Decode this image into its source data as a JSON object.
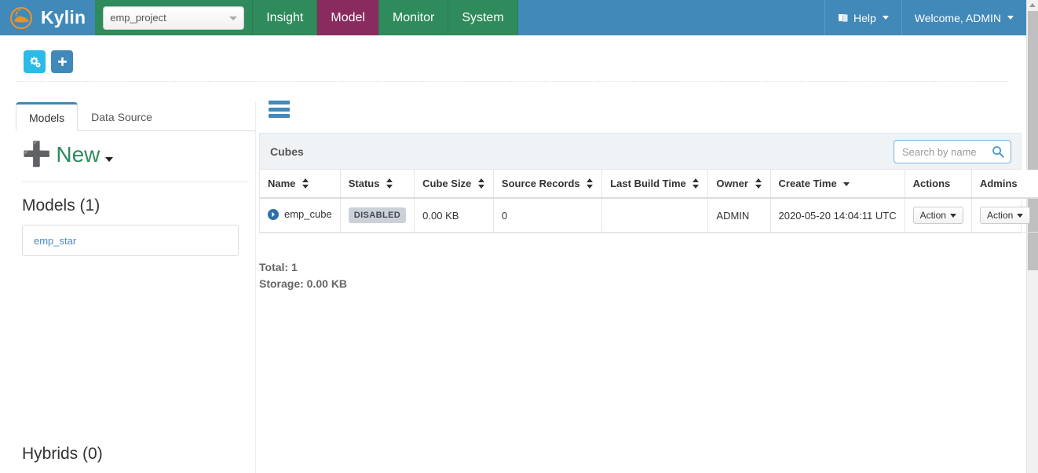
{
  "navbar": {
    "brand": "Kylin",
    "brand_logo_icon": "kylin-logo-icon",
    "project_selector": {
      "value": "emp_project",
      "icon": "chevron-down-icon"
    },
    "items": [
      {
        "label": "Insight",
        "active": false
      },
      {
        "label": "Model",
        "active": true
      },
      {
        "label": "Monitor",
        "active": false
      },
      {
        "label": "System",
        "active": false
      }
    ],
    "help": {
      "label": "Help",
      "icon": "book-icon",
      "caret": "caret-down-icon"
    },
    "user": {
      "label": "Welcome, ADMIN",
      "caret": "caret-down-icon"
    },
    "colors": {
      "bar_background": "#4189b8",
      "nav_green": "#2f8a5c",
      "nav_active": "#8a2b60"
    }
  },
  "toolbar": {
    "buttons": [
      {
        "name": "manage-project-button",
        "icon": "gears-icon",
        "color": "#2bbbe6"
      },
      {
        "name": "add-project-button",
        "icon": "plus-icon",
        "color": "#4189b8"
      }
    ]
  },
  "left_panel": {
    "tabs": [
      {
        "label": "Models",
        "active": true
      },
      {
        "label": "Data Source",
        "active": false
      }
    ],
    "new_button": {
      "label": "New",
      "plus_icon": "plus-icon",
      "caret": "caret-down-icon"
    },
    "models_section": {
      "title": "Models (1)",
      "items": [
        {
          "label": "emp_star"
        }
      ]
    },
    "hybrids_section": {
      "title": "Hybrids (0)"
    }
  },
  "content": {
    "list_toggle_icon": "hamburger-icon",
    "panel": {
      "title": "Cubes",
      "search": {
        "placeholder": "Search by name",
        "value": "",
        "icon": "search-icon"
      }
    },
    "table": {
      "columns": [
        {
          "label": "Name",
          "sort": "both"
        },
        {
          "label": "Status",
          "sort": "both"
        },
        {
          "label": "Cube Size",
          "sort": "both"
        },
        {
          "label": "Source Records",
          "sort": "both"
        },
        {
          "label": "Last Build Time",
          "sort": "both"
        },
        {
          "label": "Owner",
          "sort": "both"
        },
        {
          "label": "Create Time",
          "sort": "desc"
        },
        {
          "label": "Actions",
          "sort": "none"
        },
        {
          "label": "Admins",
          "sort": "none"
        }
      ],
      "rows": [
        {
          "name": "emp_cube",
          "name_icon": "expand-circle-right-icon",
          "status": "DISABLED",
          "cube_size": "0.00 KB",
          "source_records": "0",
          "last_build_time": "",
          "owner": "ADMIN",
          "create_time": "2020-05-20 14:04:11 UTC",
          "actions_label": "Action",
          "admins_label": "Action"
        }
      ]
    },
    "totals": {
      "total": "Total: 1",
      "storage": "Storage: 0.00 KB"
    }
  },
  "scrollbar": {
    "arrow_icon": "scroll-up-arrow-icon"
  }
}
